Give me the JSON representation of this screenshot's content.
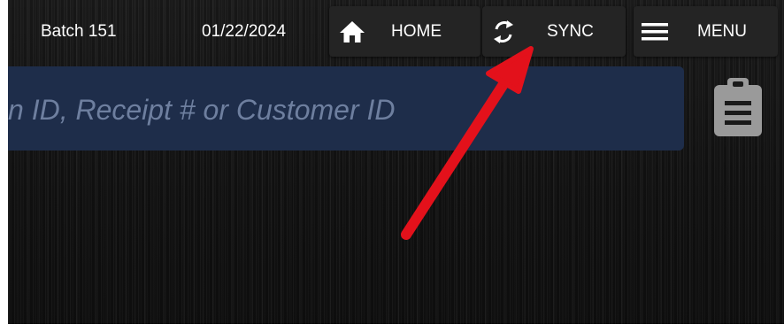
{
  "status": {
    "batch": "Batch 151",
    "date": "01/22/2024"
  },
  "nav": {
    "home": {
      "label": "HOME",
      "icon": "home-icon"
    },
    "sync": {
      "label": "SYNC",
      "icon": "sync-icon"
    },
    "menu": {
      "label": "MENU",
      "icon": "menu-icon"
    }
  },
  "search": {
    "placeholder": "n ID, Receipt # or Customer ID"
  },
  "actions": {
    "clipboard_icon": "clipboard-icon"
  },
  "annotation": {
    "arrow_color": "#e3111b",
    "arrow_target": "sync-button"
  },
  "colors": {
    "search_bg": "#1e2d4a",
    "button_bg": "#242424",
    "placeholder": "#6e7f9f"
  }
}
